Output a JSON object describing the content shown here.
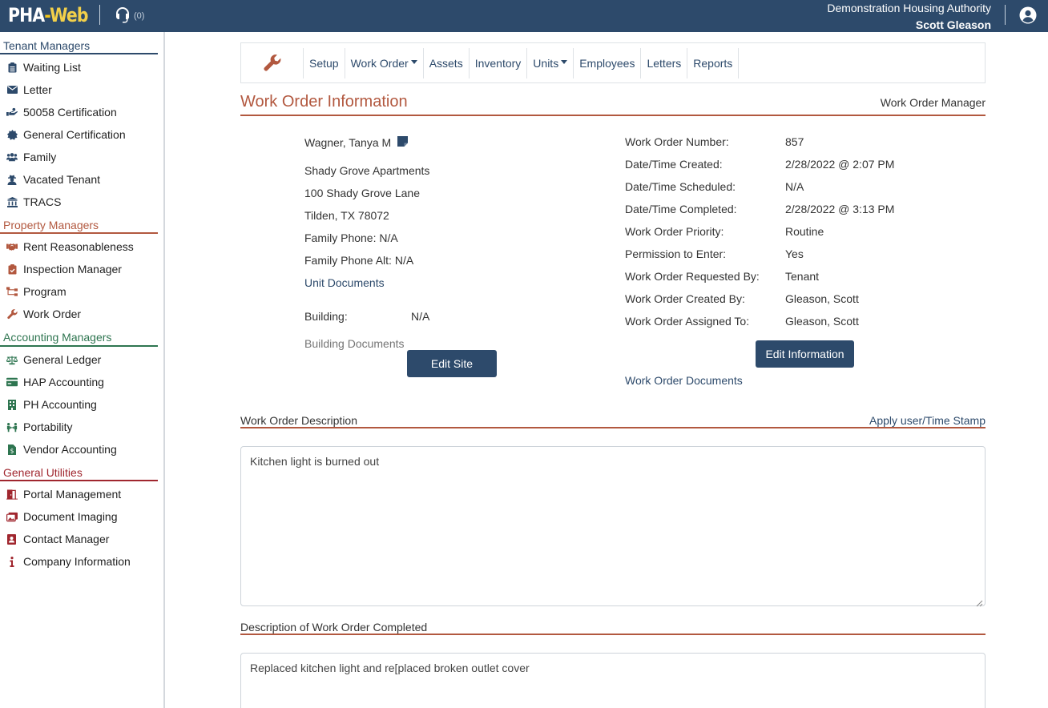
{
  "app": {
    "logo_main": "PHA",
    "logo_dash": "-",
    "logo_web": "Web",
    "support_count": "(0)",
    "authority": "Demonstration Housing Authority",
    "user": "Scott Gleason"
  },
  "sidebar": {
    "tenant": {
      "title": "Tenant Managers",
      "items": [
        {
          "label": "Waiting List",
          "icon": "clipboard-list-icon"
        },
        {
          "label": "Letter",
          "icon": "envelope-icon"
        },
        {
          "label": "50058 Certification",
          "icon": "hand-holding-icon"
        },
        {
          "label": "General Certification",
          "icon": "certificate-icon"
        },
        {
          "label": "Family",
          "icon": "users-icon"
        },
        {
          "label": "Vacated Tenant",
          "icon": "user-secret-icon"
        },
        {
          "label": "TRACS",
          "icon": "bank-icon"
        }
      ]
    },
    "property": {
      "title": "Property Managers",
      "items": [
        {
          "label": "Rent Reasonableness",
          "icon": "handshake-icon"
        },
        {
          "label": "Inspection Manager",
          "icon": "clipboard-check-icon"
        },
        {
          "label": "Program",
          "icon": "sitemap-icon"
        },
        {
          "label": "Work Order",
          "icon": "wrench-icon"
        }
      ]
    },
    "accounting": {
      "title": "Accounting Managers",
      "items": [
        {
          "label": "General Ledger",
          "icon": "balance-scale-icon"
        },
        {
          "label": "HAP Accounting",
          "icon": "credit-card-icon"
        },
        {
          "label": "PH Accounting",
          "icon": "building-icon"
        },
        {
          "label": "Portability",
          "icon": "people-arrows-icon"
        },
        {
          "label": "Vendor Accounting",
          "icon": "file-invoice-dollar-icon"
        }
      ]
    },
    "general": {
      "title": "General Utilities",
      "items": [
        {
          "label": "Portal Management",
          "icon": "door-open-icon"
        },
        {
          "label": "Document Imaging",
          "icon": "images-icon"
        },
        {
          "label": "Contact Manager",
          "icon": "address-book-icon"
        },
        {
          "label": "Company Information",
          "icon": "info-icon"
        }
      ]
    }
  },
  "toolbar": {
    "items": [
      "Setup",
      "Work Order",
      "Assets",
      "Inventory",
      "Units",
      "Employees",
      "Letters",
      "Reports"
    ]
  },
  "page": {
    "title": "Work Order Information",
    "manager": "Work Order Manager"
  },
  "tenant": {
    "name": "Wagner, Tanya M",
    "property": "Shady Grove Apartments",
    "address1": "100 Shady Grove Lane",
    "address2": "Tilden, TX 78072",
    "phone": "Family Phone: N/A",
    "phone_alt": "Family Phone Alt: N/A",
    "unit_docs": "Unit Documents",
    "building_label": "Building:",
    "building_value": "N/A",
    "building_docs": "Building Documents",
    "edit_site": "Edit Site"
  },
  "work_order": {
    "rows": [
      {
        "k": "Work Order Number:",
        "v": "857"
      },
      {
        "k": "Date/Time Created:",
        "v": "2/28/2022 @ 2:07 PM"
      },
      {
        "k": "Date/Time Scheduled:",
        "v": "N/A"
      },
      {
        "k": "Date/Time Completed:",
        "v": "2/28/2022 @ 3:13 PM"
      },
      {
        "k": "Work Order Priority:",
        "v": "Routine"
      },
      {
        "k": "Permission to Enter:",
        "v": "Yes"
      },
      {
        "k": "Work Order Requested By:",
        "v": "Tenant"
      },
      {
        "k": "Work Order Created By:",
        "v": "Gleason, Scott"
      },
      {
        "k": "Work Order Assigned To:",
        "v": "Gleason, Scott"
      }
    ],
    "edit_info": "Edit Information",
    "docs": "Work Order Documents"
  },
  "description": {
    "label": "Work Order Description",
    "stamp": "Apply user/Time Stamp",
    "text": "Kitchen light is burned out"
  },
  "completed": {
    "label": "Description of Work Order Completed",
    "text": "Replaced kitchen light and re[placed broken outlet cover"
  },
  "colors": {
    "navy": "#2d4a6b",
    "rust": "#b2583f",
    "green": "#2e7550",
    "red": "#a0262e"
  }
}
